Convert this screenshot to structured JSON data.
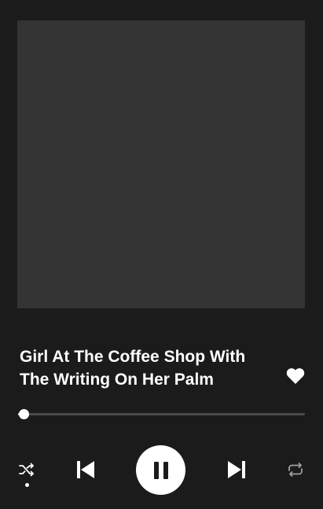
{
  "track": {
    "title": "Girl At The Coffee Shop With The Writing On Her Palm",
    "liked": true
  },
  "progress": {
    "fraction": 0.02
  },
  "controls": {
    "shuffle_icon": "shuffle-icon",
    "shuffle_active": true,
    "previous_icon": "skip-previous-icon",
    "play_state": "playing",
    "play_pause_icon": "pause-icon",
    "next_icon": "skip-next-icon",
    "repeat_icon": "repeat-icon"
  },
  "colors": {
    "background": "#1b1b1b",
    "artwork_placeholder": "#343434",
    "foreground": "#ffffff",
    "track_inactive": "#4a4a4a",
    "repeat_inactive": "#a0a0a0"
  }
}
